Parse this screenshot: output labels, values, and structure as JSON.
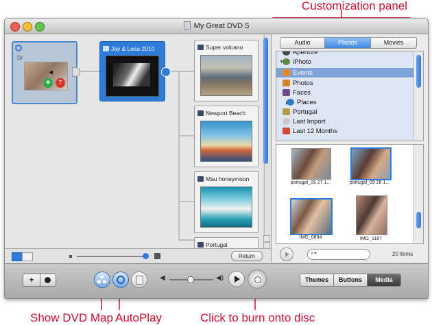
{
  "callouts": {
    "customization_panel": "Customization panel",
    "show_dvd_map": "Show DVD Map",
    "autoplay": "AutoPlay",
    "burn": "Click to burn onto disc"
  },
  "window": {
    "title": "My Great DVD 5"
  },
  "map": {
    "main_menu": {
      "overlay_text": "Dr"
    },
    "submenu": {
      "title": "Jay & Lesa 2010"
    },
    "menus": [
      {
        "title": "Super volcano"
      },
      {
        "title": "Newport Beach"
      },
      {
        "title": "Mau honeymoon"
      },
      {
        "title": "Portugal"
      }
    ],
    "return_label": "Return"
  },
  "panel": {
    "tabs": [
      "Audio",
      "Photos",
      "Movies"
    ],
    "selected_tab": "Photos",
    "sources": [
      {
        "label": "Aperture",
        "icon": "aperture-icon"
      },
      {
        "label": "iPhoto",
        "icon": "iphoto-icon"
      },
      {
        "label": "Events",
        "icon": "events-icon"
      },
      {
        "label": "Photos",
        "icon": "photos-icon"
      },
      {
        "label": "Faces",
        "icon": "faces-icon"
      },
      {
        "label": "Places",
        "icon": "places-icon"
      },
      {
        "label": "Portugal",
        "icon": "album-icon"
      },
      {
        "label": "Last Import",
        "icon": "last-import-icon"
      },
      {
        "label": "Last 12 Months",
        "icon": "calendar-icon"
      }
    ],
    "photos": [
      {
        "label": "portugal_09 27 1..."
      },
      {
        "label": "portugal_09 28 1..."
      },
      {
        "label": "IMG_0894"
      },
      {
        "label": "IMG_1167"
      }
    ],
    "search_placeholder": "",
    "item_count": "20 items"
  },
  "toolbar": {
    "themes": "Themes",
    "buttons": "Buttons",
    "media": "Media",
    "selected": "Media"
  },
  "colors": {
    "accent_blue": "#2f7bd8",
    "callout_red": "#c8102e",
    "selected_row": "#7fa3d8"
  }
}
